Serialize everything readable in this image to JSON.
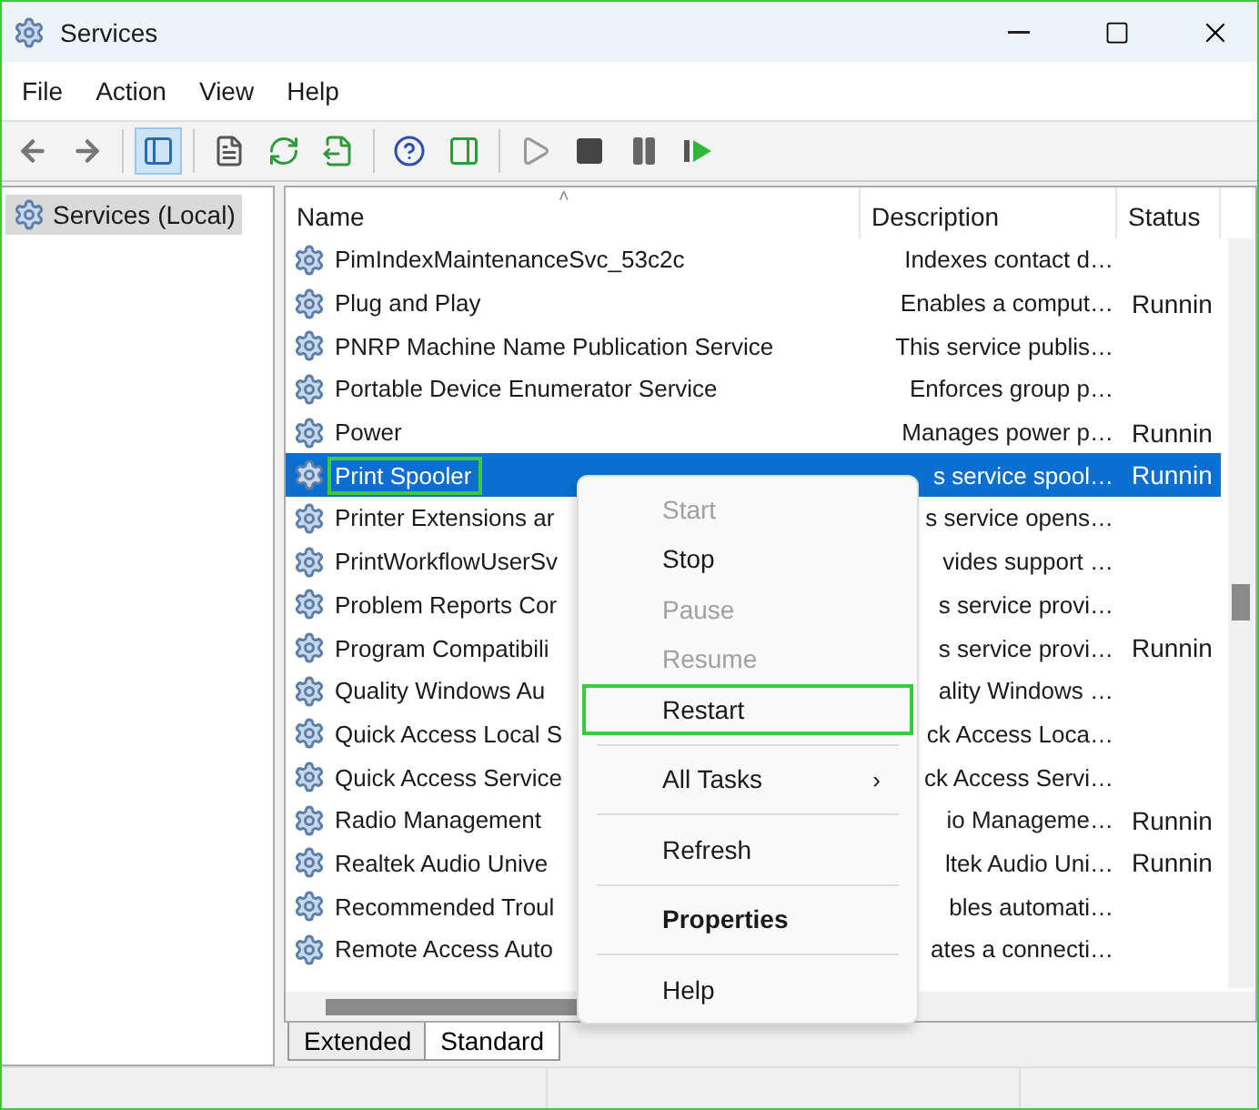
{
  "window": {
    "title": "Services"
  },
  "menu_bar": [
    "File",
    "Action",
    "View",
    "Help"
  ],
  "toolbar": [
    {
      "kind": "back",
      "active": false
    },
    {
      "kind": "forward",
      "active": false
    },
    {
      "kind": "sep"
    },
    {
      "kind": "tree",
      "active": true
    },
    {
      "kind": "sep"
    },
    {
      "kind": "props",
      "active": false
    },
    {
      "kind": "refresh",
      "active": false
    },
    {
      "kind": "export",
      "active": false
    },
    {
      "kind": "sep"
    },
    {
      "kind": "help",
      "active": false
    },
    {
      "kind": "pane",
      "active": false
    },
    {
      "kind": "sep"
    },
    {
      "kind": "play",
      "active": false
    },
    {
      "kind": "stop",
      "active": false
    },
    {
      "kind": "pause",
      "active": false
    },
    {
      "kind": "resume",
      "active": false
    }
  ],
  "tree": {
    "label": "Services (Local)",
    "selected": true
  },
  "table": {
    "sort_indicator": "˄",
    "columns": [
      "Name",
      "Description",
      "Status"
    ],
    "rows": [
      {
        "name": "PimIndexMaintenanceSvc_53c2c",
        "description": "Indexes contact d…",
        "status": "",
        "selected": false,
        "marked": false
      },
      {
        "name": "Plug and Play",
        "description": "Enables a comput…",
        "status": "Runnin",
        "selected": false,
        "marked": false
      },
      {
        "name": "PNRP Machine Name Publication Service",
        "description": "This service publis…",
        "status": "",
        "selected": false,
        "marked": false
      },
      {
        "name": "Portable Device Enumerator Service",
        "description": "Enforces group p…",
        "status": "",
        "selected": false,
        "marked": false
      },
      {
        "name": "Power",
        "description": "Manages power p…",
        "status": "Runnin",
        "selected": false,
        "marked": false
      },
      {
        "name": "Print Spooler",
        "description": "s service spool…",
        "status": "Runnin",
        "selected": true,
        "marked": true
      },
      {
        "name": "Printer Extensions ar",
        "description": "s service opens…",
        "status": "",
        "selected": false,
        "marked": false
      },
      {
        "name": "PrintWorkflowUserSv",
        "description": "vides support …",
        "status": "",
        "selected": false,
        "marked": false
      },
      {
        "name": "Problem Reports Cor",
        "description": "s service provi…",
        "status": "",
        "selected": false,
        "marked": false
      },
      {
        "name": "Program Compatibili",
        "description": "s service provi…",
        "status": "Runnin",
        "selected": false,
        "marked": false
      },
      {
        "name": "Quality Windows Au",
        "description": "ality Windows …",
        "status": "",
        "selected": false,
        "marked": false
      },
      {
        "name": "Quick Access Local S",
        "description": "ck Access Loca…",
        "status": "",
        "selected": false,
        "marked": false
      },
      {
        "name": "Quick Access Service",
        "description": "ck Access Servi…",
        "status": "",
        "selected": false,
        "marked": false
      },
      {
        "name": "Radio Management",
        "description": "io Manageme…",
        "status": "Runnin",
        "selected": false,
        "marked": false
      },
      {
        "name": "Realtek Audio Unive",
        "description": "ltek Audio Uni…",
        "status": "Runnin",
        "selected": false,
        "marked": false
      },
      {
        "name": "Recommended Troul",
        "description": "bles automati…",
        "status": "",
        "selected": false,
        "marked": false
      },
      {
        "name": "Remote Access Auto",
        "description": "ates a connecti…",
        "status": "",
        "selected": false,
        "marked": false
      }
    ]
  },
  "context_menu": [
    {
      "label": "Start",
      "disabled": true,
      "marked": false,
      "kind": "item"
    },
    {
      "label": "Stop",
      "disabled": false,
      "marked": false,
      "kind": "item"
    },
    {
      "label": "Pause",
      "disabled": true,
      "marked": false,
      "kind": "item"
    },
    {
      "label": "Resume",
      "disabled": true,
      "marked": false,
      "kind": "item"
    },
    {
      "label": "Restart",
      "disabled": false,
      "marked": true,
      "kind": "item"
    },
    {
      "kind": "separator"
    },
    {
      "label": "All Tasks",
      "disabled": false,
      "marked": false,
      "kind": "submenu",
      "arrow": "›"
    },
    {
      "kind": "separator"
    },
    {
      "label": "Refresh",
      "disabled": false,
      "marked": false,
      "kind": "item"
    },
    {
      "kind": "separator"
    },
    {
      "label": "Properties",
      "disabled": false,
      "marked": false,
      "kind": "default"
    },
    {
      "kind": "separator"
    },
    {
      "label": "Help",
      "disabled": false,
      "marked": false,
      "kind": "item"
    }
  ],
  "view_tabs": [
    {
      "label": "Extended",
      "selected": false
    },
    {
      "label": "Standard",
      "selected": true
    }
  ]
}
